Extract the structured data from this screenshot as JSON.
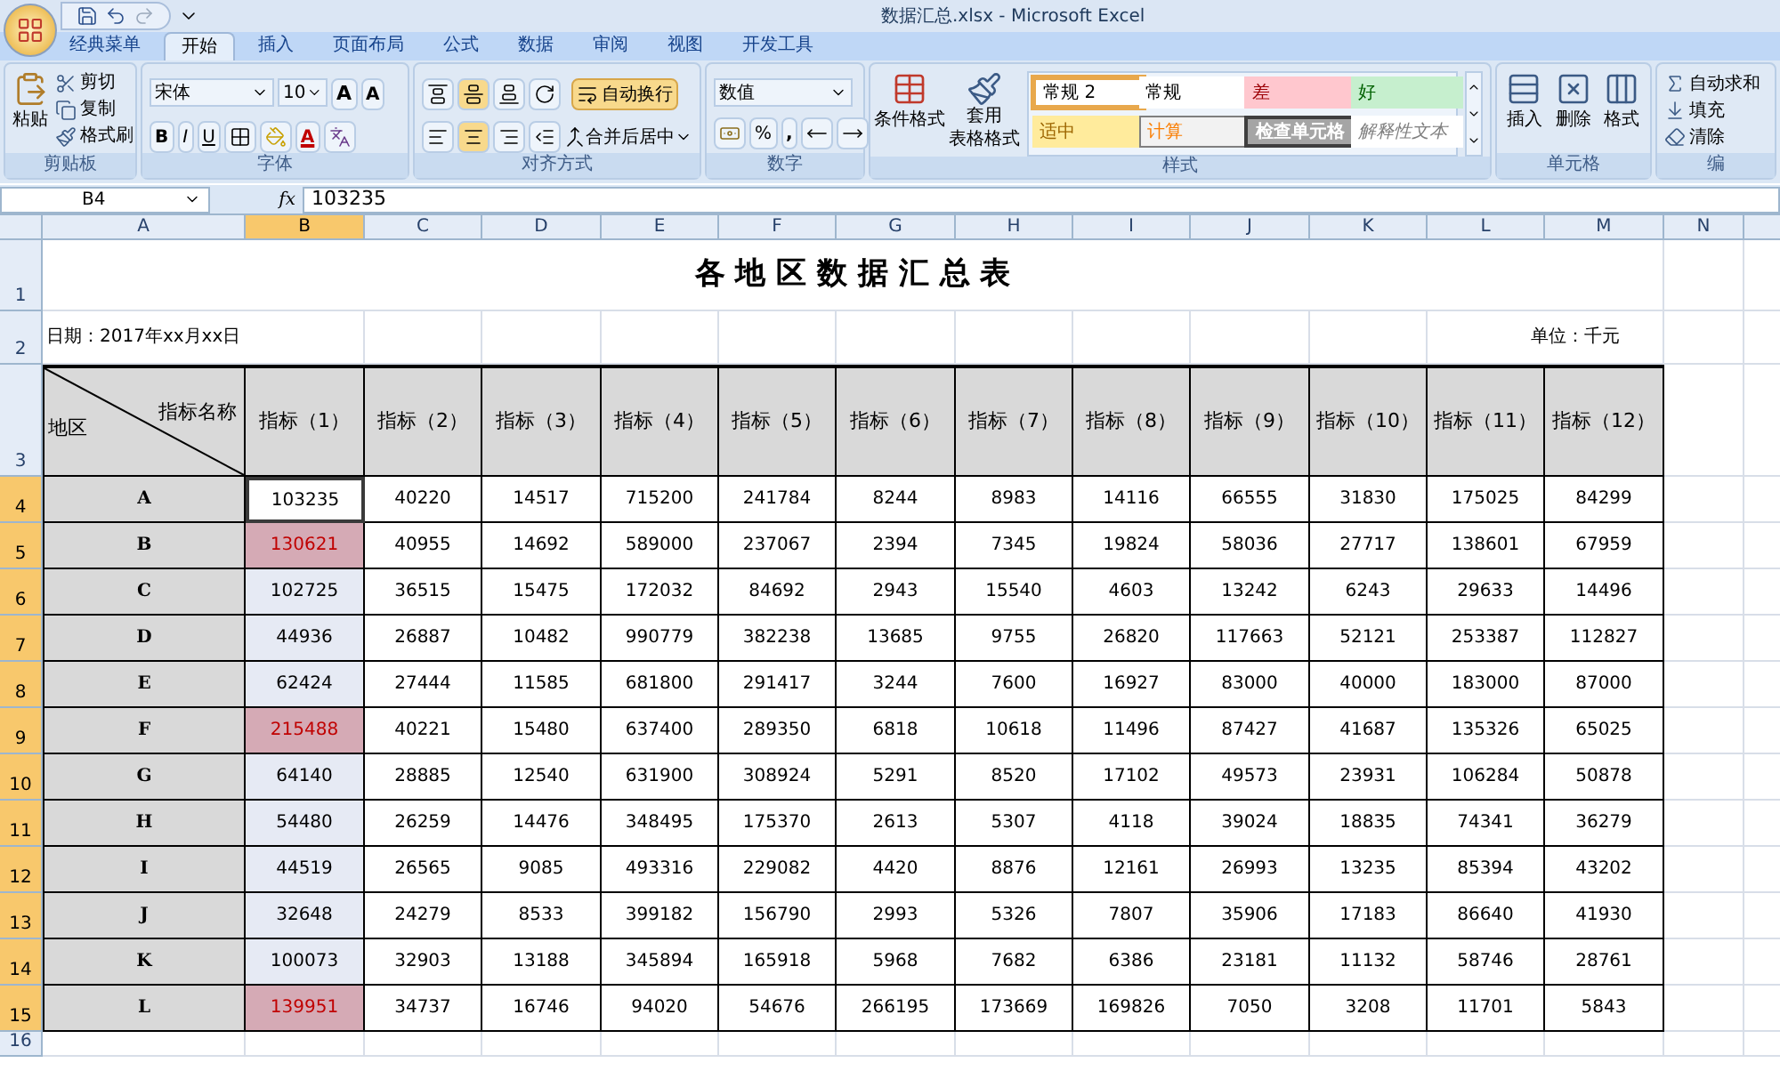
{
  "window": {
    "title": "数据汇总.xlsx - Microsoft Excel"
  },
  "tabs": [
    {
      "label": "经典菜单",
      "selected": false
    },
    {
      "label": "开始",
      "selected": true
    },
    {
      "label": "插入",
      "selected": false
    },
    {
      "label": "页面布局",
      "selected": false
    },
    {
      "label": "公式",
      "selected": false
    },
    {
      "label": "数据",
      "selected": false
    },
    {
      "label": "审阅",
      "selected": false
    },
    {
      "label": "视图",
      "selected": false
    },
    {
      "label": "开发工具",
      "selected": false
    }
  ],
  "ribbon": {
    "clipboard": {
      "label": "剪贴板",
      "paste": "粘贴",
      "items": [
        "剪切",
        "复制",
        "格式刷"
      ]
    },
    "font": {
      "label": "字体",
      "font_name": "宋体",
      "font_size": "10",
      "grow": "A",
      "shrink": "A",
      "bold": "B",
      "italic": "I",
      "underline": "U",
      "font_color": "A"
    },
    "alignment": {
      "label": "对齐方式",
      "wrap": "自动换行",
      "merge": "合并后居中"
    },
    "number": {
      "label": "数字",
      "format": "数值",
      "percent": "%",
      "comma": ","
    },
    "styles": {
      "label": "样式",
      "conditional": "条件格式",
      "table_format": [
        "套用",
        "表格格式"
      ],
      "cell_styles": [
        {
          "text": "常规 2",
          "kind": "normal2",
          "selected": true
        },
        {
          "text": "常规",
          "kind": "normal",
          "selected": false
        },
        {
          "text": "差",
          "kind": "bad",
          "selected": false
        },
        {
          "text": "好",
          "kind": "good",
          "selected": false
        },
        {
          "text": "适中",
          "kind": "neutral",
          "selected": false
        },
        {
          "text": "计算",
          "kind": "calculation",
          "selected": false
        },
        {
          "text": "检查单元格",
          "kind": "check",
          "selected": false
        },
        {
          "text": "解释性文本",
          "kind": "explanatory",
          "selected": false
        }
      ]
    },
    "cells": {
      "label": "单元格",
      "buttons": [
        "插入",
        "删除",
        "格式"
      ]
    },
    "editing": {
      "label": "编",
      "items": [
        "自动求和",
        "填充",
        "清除"
      ]
    }
  },
  "formula_bar": {
    "name_box": "B4",
    "fx": "fx",
    "value": "103235"
  },
  "sheet": {
    "columns": [
      {
        "label": "A",
        "selected": false
      },
      {
        "label": "B",
        "selected": true
      },
      {
        "label": "C",
        "selected": false
      },
      {
        "label": "D",
        "selected": false
      },
      {
        "label": "E",
        "selected": false
      },
      {
        "label": "F",
        "selected": false
      },
      {
        "label": "G",
        "selected": false
      },
      {
        "label": "H",
        "selected": false
      },
      {
        "label": "I",
        "selected": false
      },
      {
        "label": "J",
        "selected": false
      },
      {
        "label": "K",
        "selected": false
      },
      {
        "label": "L",
        "selected": false
      },
      {
        "label": "M",
        "selected": false
      },
      {
        "label": "N",
        "selected": false
      }
    ],
    "row_numbers": [
      {
        "label": "1",
        "selected": false
      },
      {
        "label": "2",
        "selected": false
      },
      {
        "label": "3",
        "selected": false
      },
      {
        "label": "4",
        "selected": true
      },
      {
        "label": "5",
        "selected": true
      },
      {
        "label": "6",
        "selected": true
      },
      {
        "label": "7",
        "selected": true
      },
      {
        "label": "8",
        "selected": true
      },
      {
        "label": "9",
        "selected": true
      },
      {
        "label": "10",
        "selected": true
      },
      {
        "label": "11",
        "selected": true
      },
      {
        "label": "12",
        "selected": true
      },
      {
        "label": "13",
        "selected": true
      },
      {
        "label": "14",
        "selected": true
      },
      {
        "label": "15",
        "selected": true
      },
      {
        "label": "16",
        "selected": false
      }
    ],
    "title": "各 地 区 数 据 汇 总 表",
    "date": "日期：2017年xx月xx日",
    "unit": "单位：千元",
    "corner": {
      "top": "指标名称",
      "bottom": "地区"
    },
    "headers": [
      "指标（1）",
      "指标（2）",
      "指标（3）",
      "指标（4）",
      "指标（5）",
      "指标（6）",
      "指标（7）",
      "指标（8）",
      "指标（9）",
      "指标（10）",
      "指标（11）",
      "指标（12）"
    ],
    "rows": [
      {
        "region": "A",
        "first": {
          "value": "103235",
          "active": true,
          "flagged": false
        },
        "values": [
          "40220",
          "14517",
          "715200",
          "241784",
          "8244",
          "8983",
          "14116",
          "66555",
          "31830",
          "175025",
          "84299"
        ]
      },
      {
        "region": "B",
        "first": {
          "value": "130621",
          "active": false,
          "flagged": true
        },
        "values": [
          "40955",
          "14692",
          "589000",
          "237067",
          "2394",
          "7345",
          "19824",
          "58036",
          "27717",
          "138601",
          "67959"
        ]
      },
      {
        "region": "C",
        "first": {
          "value": "102725",
          "active": false,
          "flagged": false
        },
        "values": [
          "36515",
          "15475",
          "172032",
          "84692",
          "2943",
          "15540",
          "4603",
          "13242",
          "6243",
          "29633",
          "14496"
        ]
      },
      {
        "region": "D",
        "first": {
          "value": "44936",
          "active": false,
          "flagged": false
        },
        "values": [
          "26887",
          "10482",
          "990779",
          "382238",
          "13685",
          "9755",
          "26820",
          "117663",
          "52121",
          "253387",
          "112827"
        ]
      },
      {
        "region": "E",
        "first": {
          "value": "62424",
          "active": false,
          "flagged": false
        },
        "values": [
          "27444",
          "11585",
          "681800",
          "291417",
          "3244",
          "7600",
          "16927",
          "83000",
          "40000",
          "183000",
          "87000"
        ]
      },
      {
        "region": "F",
        "first": {
          "value": "215488",
          "active": false,
          "flagged": true
        },
        "values": [
          "40221",
          "15480",
          "637400",
          "289350",
          "6818",
          "10618",
          "11496",
          "87427",
          "41687",
          "135326",
          "65025"
        ]
      },
      {
        "region": "G",
        "first": {
          "value": "64140",
          "active": false,
          "flagged": false
        },
        "values": [
          "28885",
          "12540",
          "631900",
          "308924",
          "5291",
          "8520",
          "17102",
          "49573",
          "23931",
          "106284",
          "50878"
        ]
      },
      {
        "region": "H",
        "first": {
          "value": "54480",
          "active": false,
          "flagged": false
        },
        "values": [
          "26259",
          "14476",
          "348495",
          "175370",
          "2613",
          "5307",
          "4118",
          "39024",
          "18835",
          "74341",
          "36279"
        ]
      },
      {
        "region": "I",
        "first": {
          "value": "44519",
          "active": false,
          "flagged": false
        },
        "values": [
          "26565",
          "9085",
          "493316",
          "229082",
          "4420",
          "8876",
          "12161",
          "26993",
          "13235",
          "85394",
          "43202"
        ]
      },
      {
        "region": "J",
        "first": {
          "value": "32648",
          "active": false,
          "flagged": false
        },
        "values": [
          "24279",
          "8533",
          "399182",
          "156790",
          "2993",
          "5326",
          "7807",
          "35906",
          "17183",
          "86640",
          "41930"
        ]
      },
      {
        "region": "K",
        "first": {
          "value": "100073",
          "active": false,
          "flagged": false
        },
        "values": [
          "32903",
          "13188",
          "345894",
          "165918",
          "5968",
          "7682",
          "6386",
          "23181",
          "11132",
          "58746",
          "28761"
        ]
      },
      {
        "region": "L",
        "first": {
          "value": "139951",
          "active": false,
          "flagged": true
        },
        "values": [
          "34737",
          "16746",
          "94020",
          "54676",
          "266195",
          "173669",
          "169826",
          "7050",
          "3208",
          "11701",
          "5843"
        ]
      }
    ]
  }
}
